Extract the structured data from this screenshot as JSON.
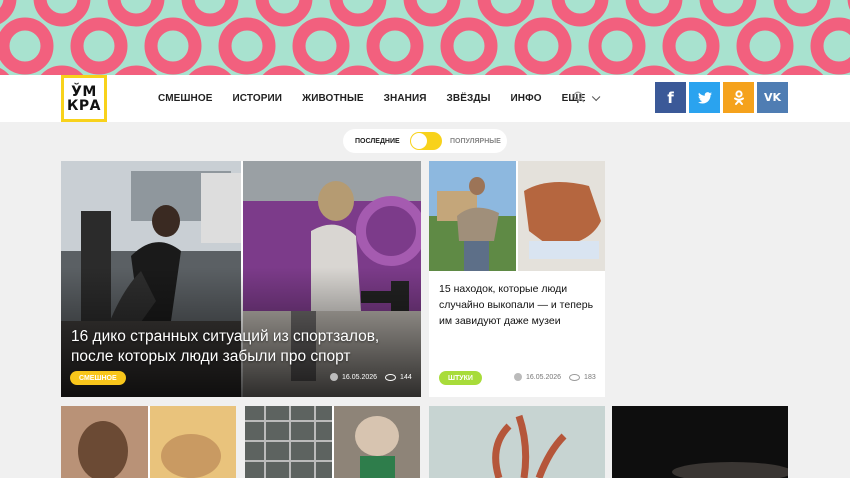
{
  "brand": {
    "logo_line1": "ЎМ",
    "logo_line2": "КРА",
    "color": "#f8d21b"
  },
  "nav": {
    "items": [
      "СМЕШНОЕ",
      "ИСТОРИИ",
      "ЖИВОТНЫЕ",
      "ЗНАНИЯ",
      "ЗВЁЗДЫ",
      "ИНФО",
      "ЕЩЕ"
    ],
    "search_icon": "search-icon"
  },
  "social": [
    {
      "name": "facebook",
      "glyph": "f",
      "color": "#3b5998"
    },
    {
      "name": "twitter",
      "glyph": "t",
      "color": "#2aa3ef"
    },
    {
      "name": "odnoklassniki",
      "glyph": "ок",
      "color": "#f5a21c"
    },
    {
      "name": "vk",
      "glyph": "vk",
      "color": "#4f7db3"
    }
  ],
  "sort": {
    "left": "ПОСЛЕДНИЕ",
    "right": "ПОПУЛЯРНЫЕ"
  },
  "cards": [
    {
      "title": "16 дико странных ситуаций из спортзалов, после которых люди забыли про спорт",
      "tag": "СМЕШНОЕ",
      "tag_color": "#f8c61b",
      "date": "16.05.2026",
      "views": "144"
    },
    {
      "title": "15 находок, которые люди случайно выкопали — и теперь им завидуют даже музеи",
      "tag": "ШТУКИ",
      "tag_color": "#a8dc3a",
      "date": "16.05.2026",
      "views": "183"
    }
  ]
}
